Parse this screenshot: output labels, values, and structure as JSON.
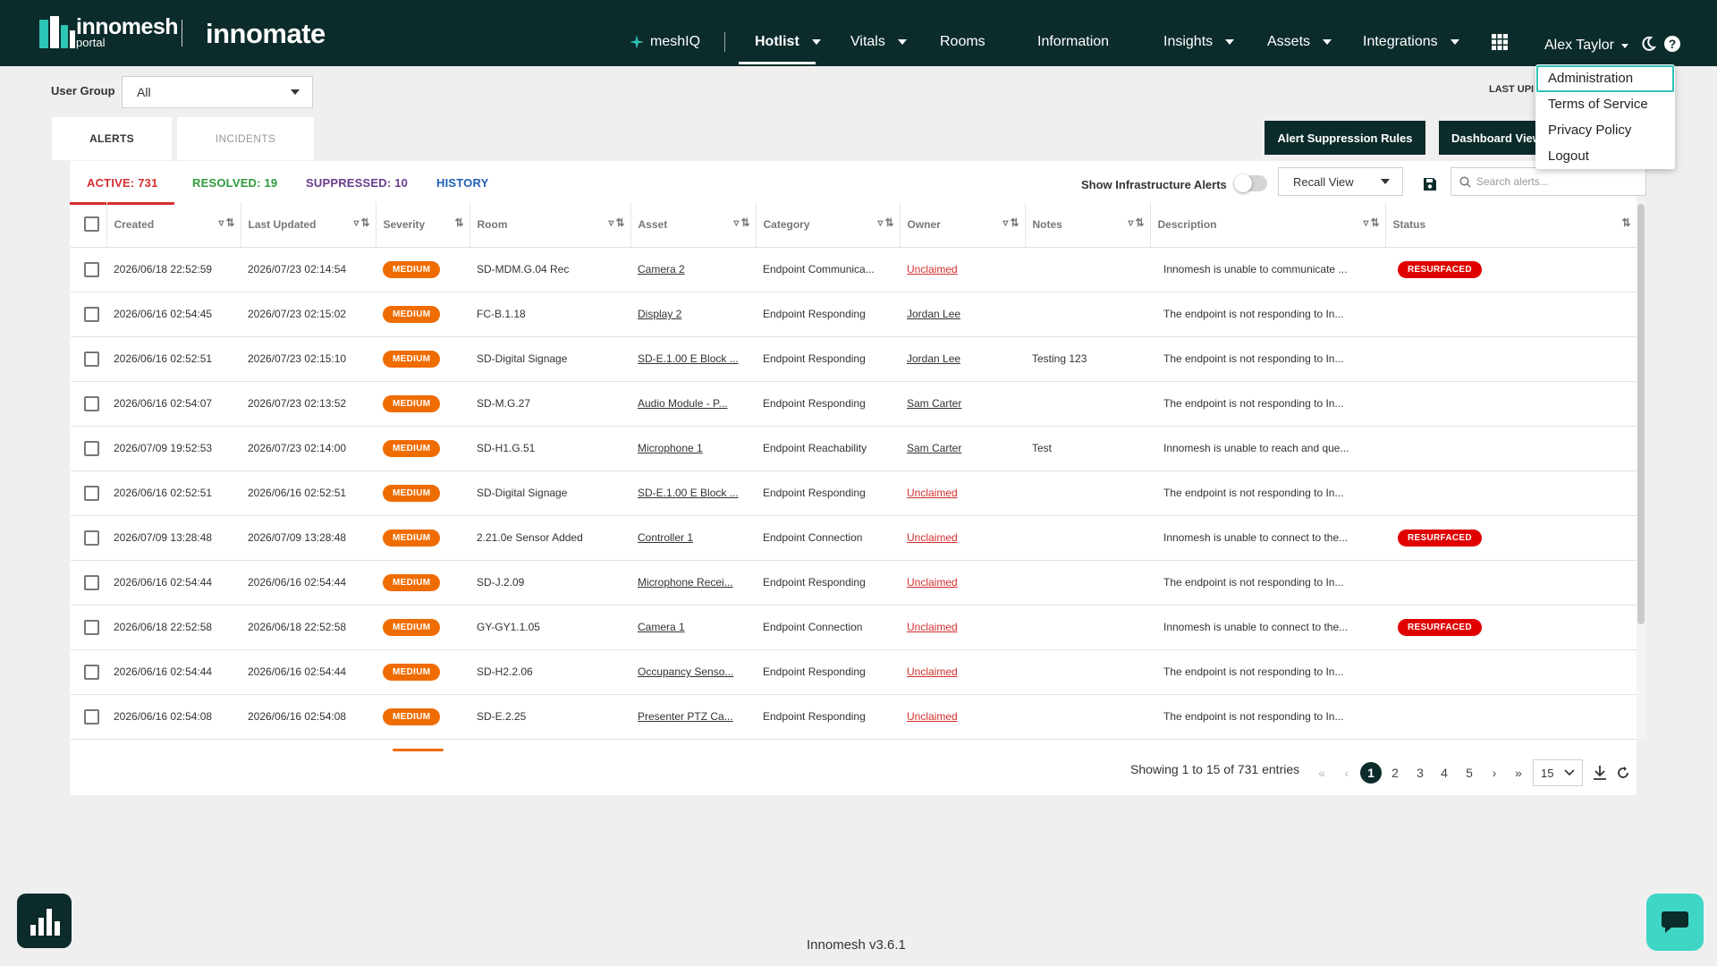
{
  "brand": {
    "primary": "innomesh",
    "sub": "portal",
    "product": "innomate",
    "color": "#0c2b2b"
  },
  "nav": {
    "items": [
      {
        "label": "meshIQ",
        "icon": "sparkle-icon"
      },
      {
        "label": "Hotlist",
        "dropdown": true,
        "active": true
      },
      {
        "label": "Vitals",
        "dropdown": true
      },
      {
        "label": "Rooms"
      },
      {
        "label": "Information"
      },
      {
        "label": "Insights",
        "dropdown": true
      },
      {
        "label": "Assets",
        "dropdown": true
      },
      {
        "label": "Integrations",
        "dropdown": true
      }
    ],
    "user": "Alex Taylor"
  },
  "user_menu": {
    "items": [
      "Administration",
      "Terms of Service",
      "Privacy Policy",
      "Logout"
    ],
    "highlighted": "Administration"
  },
  "filters": {
    "user_group_label": "User Group",
    "user_group_value": "All",
    "last_updated_label": "LAST UPI"
  },
  "tabs": {
    "alerts": "ALERTS",
    "incidents": "INCIDENTS"
  },
  "buttons": {
    "suppression": "Alert Suppression Rules",
    "dashboard": "Dashboard View"
  },
  "subtabs": {
    "active": "ACTIVE: 731",
    "resolved": "RESOLVED: 19",
    "suppressed": "SUPPRESSED: 10",
    "history": "HISTORY"
  },
  "toolbar": {
    "infra_label": "Show Infrastructure Alerts",
    "recall_view": "Recall View",
    "search_placeholder": "Search alerts..."
  },
  "columns": [
    "Created",
    "Last Updated",
    "Severity",
    "Room",
    "Asset",
    "Category",
    "Owner",
    "Notes",
    "Description",
    "Status"
  ],
  "rows": [
    {
      "created": "2026/06/18 22:52:59",
      "updated": "2026/07/23 02:14:54",
      "severity": "MEDIUM",
      "room": "SD-MDM.G.04 Rec",
      "asset": "Camera 2",
      "category": "Endpoint Communica...",
      "owner": "Unclaimed",
      "notes": "",
      "description": "Innomesh is unable to communicate ...",
      "status": "RESURFACED"
    },
    {
      "created": "2026/06/16 02:54:45",
      "updated": "2026/07/23 02:15:02",
      "severity": "MEDIUM",
      "room": "FC-B.1.18",
      "asset": "Display 2",
      "category": "Endpoint Responding",
      "owner": "Jordan Lee",
      "notes": "",
      "description": "The endpoint is not responding to In...",
      "status": ""
    },
    {
      "created": "2026/06/16 02:52:51",
      "updated": "2026/07/23 02:15:10",
      "severity": "MEDIUM",
      "room": "SD-Digital Signage",
      "asset": "SD-E.1.00 E Block ...",
      "category": "Endpoint Responding",
      "owner": "Jordan Lee",
      "notes": "Testing 123",
      "description": "The endpoint is not responding to In...",
      "status": ""
    },
    {
      "created": "2026/06/16 02:54:07",
      "updated": "2026/07/23 02:13:52",
      "severity": "MEDIUM",
      "room": "SD-M.G.27",
      "asset": "Audio Module - P...",
      "category": "Endpoint Responding",
      "owner": "Sam Carter",
      "notes": "",
      "description": "The endpoint is not responding to In...",
      "status": ""
    },
    {
      "created": "2026/07/09 19:52:53",
      "updated": "2026/07/23 02:14:00",
      "severity": "MEDIUM",
      "room": "SD-H1.G.51",
      "asset": "Microphone 1",
      "category": "Endpoint Reachability",
      "owner": "Sam Carter",
      "notes": "Test",
      "description": "Innomesh is unable to reach and que...",
      "status": ""
    },
    {
      "created": "2026/06/16 02:52:51",
      "updated": "2026/06/16 02:52:51",
      "severity": "MEDIUM",
      "room": "SD-Digital Signage",
      "asset": "SD-E.1.00 E Block ...",
      "category": "Endpoint Responding",
      "owner": "Unclaimed",
      "notes": "",
      "description": "The endpoint is not responding to In...",
      "status": ""
    },
    {
      "created": "2026/07/09 13:28:48",
      "updated": "2026/07/09 13:28:48",
      "severity": "MEDIUM",
      "room": "2.21.0e Sensor Added",
      "asset": "Controller 1",
      "category": "Endpoint Connection",
      "owner": "Unclaimed",
      "notes": "",
      "description": "Innomesh is unable to connect to the...",
      "status": "RESURFACED"
    },
    {
      "created": "2026/06/16 02:54:44",
      "updated": "2026/06/16 02:54:44",
      "severity": "MEDIUM",
      "room": "SD-J.2.09",
      "asset": "Microphone Recei...",
      "category": "Endpoint Responding",
      "owner": "Unclaimed",
      "notes": "",
      "description": "The endpoint is not responding to In...",
      "status": ""
    },
    {
      "created": "2026/06/18 22:52:58",
      "updated": "2026/06/18 22:52:58",
      "severity": "MEDIUM",
      "room": "GY-GY1.1.05",
      "asset": "Camera 1",
      "category": "Endpoint Connection",
      "owner": "Unclaimed",
      "notes": "",
      "description": "Innomesh is unable to connect to the...",
      "status": "RESURFACED"
    },
    {
      "created": "2026/06/16 02:54:44",
      "updated": "2026/06/16 02:54:44",
      "severity": "MEDIUM",
      "room": "SD-H2.2.06",
      "asset": "Occupancy Senso...",
      "category": "Endpoint Responding",
      "owner": "Unclaimed",
      "notes": "",
      "description": "The endpoint is not responding to In...",
      "status": ""
    },
    {
      "created": "2026/06/16 02:54:08",
      "updated": "2026/06/16 02:54:08",
      "severity": "MEDIUM",
      "room": "SD-E.2.25",
      "asset": "Presenter PTZ Ca...",
      "category": "Endpoint Responding",
      "owner": "Unclaimed",
      "notes": "",
      "description": "The endpoint is not responding to In...",
      "status": ""
    }
  ],
  "pagination": {
    "summary": "Showing 1 to 15 of 731 entries",
    "pages": [
      "1",
      "2",
      "3",
      "4",
      "5"
    ],
    "current": "1",
    "page_size": "15"
  },
  "footer": {
    "version": "Innomesh v3.6.1"
  }
}
